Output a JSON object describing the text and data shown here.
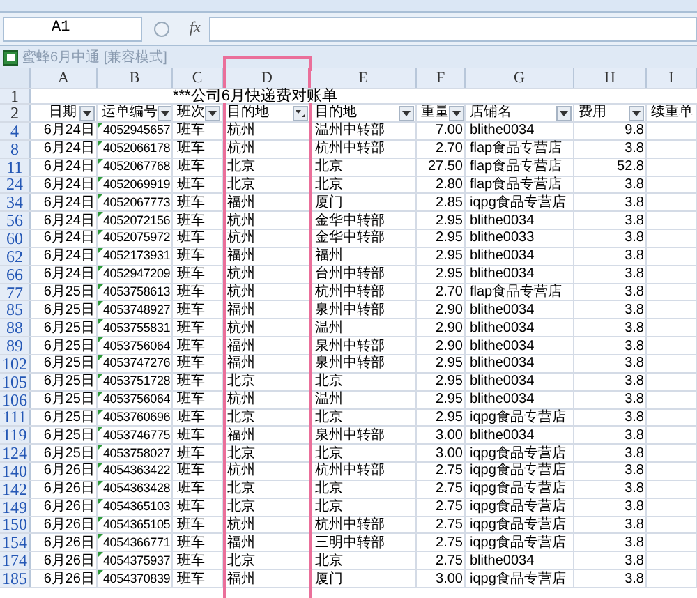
{
  "name_box": "A1",
  "formula_icon": "fx",
  "workbook_title": "蜜蜂6月中通  [兼容模式]",
  "columns": [
    "A",
    "B",
    "C",
    "D",
    "E",
    "F",
    "G",
    "H",
    "I"
  ],
  "title_row": {
    "number": "1",
    "text": "***公司6月快递费对账单"
  },
  "header_row": {
    "number": "2",
    "cells": [
      {
        "text": "日期",
        "filtered": false
      },
      {
        "text": "运单编号",
        "filtered": false
      },
      {
        "text": "班次",
        "filtered": false
      },
      {
        "text": "目的地",
        "filtered": true
      },
      {
        "text": "目的地",
        "filtered": false
      },
      {
        "text": "重量",
        "filtered": false
      },
      {
        "text": "店铺名",
        "filtered": false
      },
      {
        "text": "费用",
        "filtered": false
      },
      {
        "text": "续重单"
      }
    ]
  },
  "rows": [
    [
      "4",
      "6月24日",
      "4052945657",
      "班车",
      "杭州",
      "温州中转部",
      "7.00",
      "blithe0034",
      "9.8"
    ],
    [
      "8",
      "6月24日",
      "4052066178",
      "班车",
      "杭州",
      "杭州中转部",
      "2.70",
      "flap食品专营店",
      "3.8"
    ],
    [
      "11",
      "6月24日",
      "4052067768",
      "班车",
      "北京",
      "北京",
      "27.50",
      "flap食品专营店",
      "52.8"
    ],
    [
      "24",
      "6月24日",
      "4052069919",
      "班车",
      "北京",
      "北京",
      "2.80",
      "flap食品专营店",
      "3.8"
    ],
    [
      "34",
      "6月24日",
      "4052067773",
      "班车",
      "福州",
      "厦门",
      "2.85",
      "iqpg食品专营店",
      "3.8"
    ],
    [
      "56",
      "6月24日",
      "4052072156",
      "班车",
      "杭州",
      "金华中转部",
      "2.95",
      "blithe0034",
      "3.8"
    ],
    [
      "60",
      "6月24日",
      "4052075972",
      "班车",
      "杭州",
      "金华中转部",
      "2.95",
      "blithe0033",
      "3.8"
    ],
    [
      "62",
      "6月24日",
      "4052173931",
      "班车",
      "福州",
      "福州",
      "2.95",
      "blithe0034",
      "3.8"
    ],
    [
      "66",
      "6月24日",
      "4052947209",
      "班车",
      "杭州",
      "台州中转部",
      "2.95",
      "blithe0034",
      "3.8"
    ],
    [
      "77",
      "6月25日",
      "4053758613",
      "班车",
      "杭州",
      "杭州中转部",
      "2.70",
      "flap食品专营店",
      "3.8"
    ],
    [
      "85",
      "6月25日",
      "4053748927",
      "班车",
      "福州",
      "泉州中转部",
      "2.90",
      "blithe0034",
      "3.8"
    ],
    [
      "88",
      "6月25日",
      "4053755831",
      "班车",
      "杭州",
      "温州",
      "2.90",
      "blithe0034",
      "3.8"
    ],
    [
      "89",
      "6月25日",
      "4053756064",
      "班车",
      "福州",
      "泉州中转部",
      "2.90",
      "blithe0034",
      "3.8"
    ],
    [
      "102",
      "6月25日",
      "4053747276",
      "班车",
      "福州",
      "泉州中转部",
      "2.95",
      "blithe0034",
      "3.8"
    ],
    [
      "105",
      "6月25日",
      "4053751728",
      "班车",
      "北京",
      "北京",
      "2.95",
      "blithe0034",
      "3.8"
    ],
    [
      "106",
      "6月25日",
      "4053756064",
      "班车",
      "杭州",
      "温州",
      "2.95",
      "blithe0034",
      "3.8"
    ],
    [
      "111",
      "6月25日",
      "4053760696",
      "班车",
      "北京",
      "北京",
      "2.95",
      "iqpg食品专营店",
      "3.8"
    ],
    [
      "119",
      "6月25日",
      "4053746775",
      "班车",
      "福州",
      "泉州中转部",
      "3.00",
      "blithe0034",
      "3.8"
    ],
    [
      "124",
      "6月25日",
      "4053758027",
      "班车",
      "北京",
      "北京",
      "3.00",
      "iqpg食品专营店",
      "3.8"
    ],
    [
      "140",
      "6月26日",
      "4054363422",
      "班车",
      "杭州",
      "杭州中转部",
      "2.75",
      "iqpg食品专营店",
      "3.8"
    ],
    [
      "142",
      "6月26日",
      "4054363428",
      "班车",
      "北京",
      "北京",
      "2.75",
      "iqpg食品专营店",
      "3.8"
    ],
    [
      "149",
      "6月26日",
      "4054365103",
      "班车",
      "北京",
      "北京",
      "2.75",
      "iqpg食品专营店",
      "3.8"
    ],
    [
      "150",
      "6月26日",
      "4054365105",
      "班车",
      "杭州",
      "杭州中转部",
      "2.75",
      "iqpg食品专营店",
      "3.8"
    ],
    [
      "154",
      "6月26日",
      "4054366771",
      "班车",
      "福州",
      "三明中转部",
      "2.75",
      "iqpg食品专营店",
      "3.8"
    ],
    [
      "174",
      "6月26日",
      "4054375937",
      "班车",
      "北京",
      "北京",
      "2.75",
      "blithe0034",
      "3.8"
    ],
    [
      "185",
      "6月26日",
      "4054370839",
      "班车",
      "福州",
      "厦门",
      "3.00",
      "iqpg食品专营店",
      "3.8"
    ]
  ]
}
